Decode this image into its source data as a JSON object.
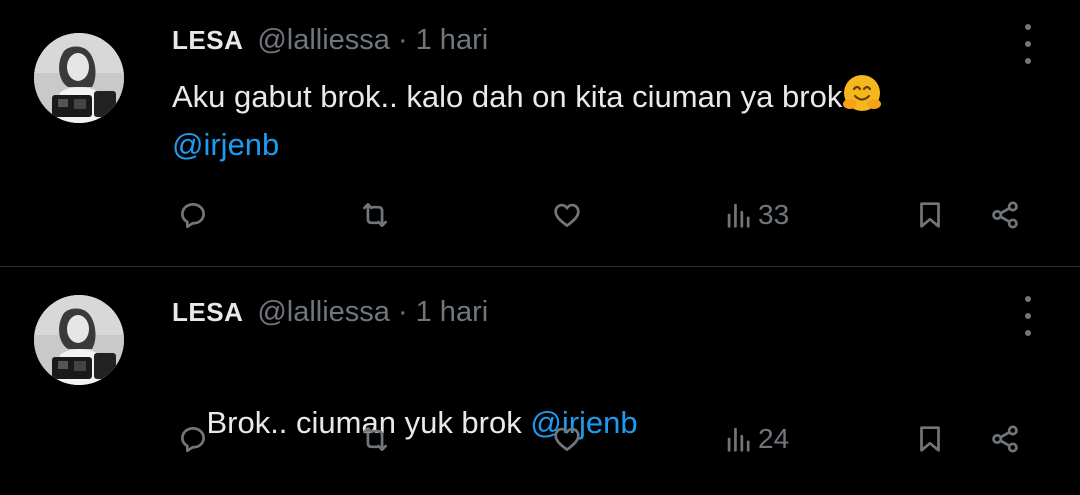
{
  "tweets": [
    {
      "author_name": "LESA",
      "handle": "@lalliessa",
      "separator": "·",
      "time": "1 hari",
      "text_line1": "Aku gabut brok.. kalo dah on kita ciuman ya brok",
      "emoji": "hugging-face-emoji",
      "mention": "@irjenb",
      "views": "33"
    },
    {
      "author_name": "LESA",
      "handle": "@lalliessa",
      "separator": "·",
      "time": "1 hari",
      "text": "Brok.. ciuman yuk brok ",
      "mention": "@irjenb",
      "views": "24"
    }
  ],
  "icons": {
    "reply": "speech-bubble-icon",
    "retweet": "retweet-icon",
    "like": "heart-icon",
    "views": "bar-chart-icon",
    "bookmark": "bookmark-icon",
    "share": "share-icon",
    "more": "vertical-dots-icon"
  },
  "colors": {
    "background": "#000000",
    "text": "#e7e9ea",
    "secondary": "#71767b",
    "accent": "#1d9bf0",
    "divider": "#2f3336"
  }
}
